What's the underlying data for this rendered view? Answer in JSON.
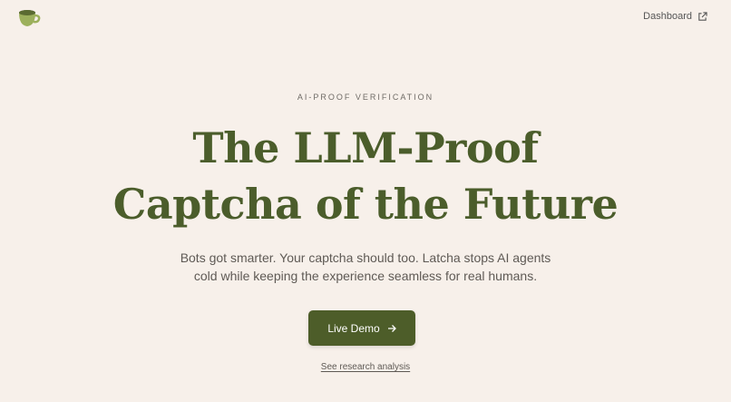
{
  "header": {
    "logo_icon": "coffee-cup-icon",
    "dashboard_label": "Dashboard",
    "dashboard_icon": "external-link-icon"
  },
  "hero": {
    "eyebrow": "AI-PROOF VERIFICATION",
    "title_line_1": "The LLM-Proof",
    "title_line_2": "Captcha of the Future",
    "subtitle_line_1": "Bots got smarter. Your captcha should too. Latcha stops AI agents",
    "subtitle_line_2": "cold while keeping the experience seamless for real humans.",
    "cta_label": "Live Demo",
    "cta_icon": "arrow-right-icon",
    "secondary_link": "See research analysis"
  },
  "colors": {
    "background": "#f7f0ea",
    "accent": "#4d5d29",
    "title": "#4b5d2b",
    "text_muted": "#5f5a55"
  }
}
